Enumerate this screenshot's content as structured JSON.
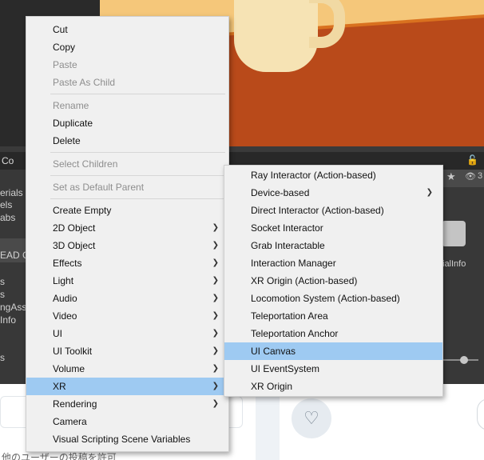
{
  "editor": {
    "panel_title": "Co",
    "hidden_count": "3",
    "left_items": [
      "erials",
      "els",
      "abs",
      "EAD G",
      "s",
      "s",
      "ngAss",
      "Info",
      "s"
    ],
    "right_item_label": "ialInfo"
  },
  "web": {
    "bottom_text": "他のユーザーの投稿を許可"
  },
  "context_menu": {
    "items": [
      {
        "label": "Cut",
        "disabled": false
      },
      {
        "label": "Copy",
        "disabled": false
      },
      {
        "label": "Paste",
        "disabled": true
      },
      {
        "label": "Paste As Child",
        "disabled": true
      },
      {
        "label": "Rename",
        "disabled": true
      },
      {
        "label": "Duplicate",
        "disabled": false
      },
      {
        "label": "Delete",
        "disabled": false
      },
      {
        "label": "Select Children",
        "disabled": true
      },
      {
        "label": "Set as Default Parent",
        "disabled": true
      },
      {
        "label": "Create Empty",
        "disabled": false
      },
      {
        "label": "2D Object",
        "disabled": false,
        "submenu": true
      },
      {
        "label": "3D Object",
        "disabled": false,
        "submenu": true
      },
      {
        "label": "Effects",
        "disabled": false,
        "submenu": true
      },
      {
        "label": "Light",
        "disabled": false,
        "submenu": true
      },
      {
        "label": "Audio",
        "disabled": false,
        "submenu": true
      },
      {
        "label": "Video",
        "disabled": false,
        "submenu": true
      },
      {
        "label": "UI",
        "disabled": false,
        "submenu": true
      },
      {
        "label": "UI Toolkit",
        "disabled": false,
        "submenu": true
      },
      {
        "label": "Volume",
        "disabled": false,
        "submenu": true
      },
      {
        "label": "XR",
        "disabled": false,
        "submenu": true,
        "highlighted": true
      },
      {
        "label": "Rendering",
        "disabled": false,
        "submenu": true
      },
      {
        "label": "Camera",
        "disabled": false
      },
      {
        "label": "Visual Scripting Scene Variables",
        "disabled": false
      }
    ]
  },
  "xr_submenu": {
    "items": [
      {
        "label": "Ray Interactor (Action-based)"
      },
      {
        "label": "Device-based",
        "submenu": true
      },
      {
        "label": "Direct Interactor (Action-based)"
      },
      {
        "label": "Socket Interactor"
      },
      {
        "label": "Grab Interactable"
      },
      {
        "label": "Interaction Manager"
      },
      {
        "label": "XR Origin (Action-based)"
      },
      {
        "label": "Locomotion System (Action-based)"
      },
      {
        "label": "Teleportation Area"
      },
      {
        "label": "Teleportation Anchor"
      },
      {
        "label": "UI Canvas",
        "highlighted": true
      },
      {
        "label": "UI EventSystem"
      },
      {
        "label": "XR Origin"
      }
    ]
  },
  "icons": {
    "submenu_arrow": "chevron-right-icon",
    "lock": "lock-icon",
    "favorite": "star-icon",
    "visibility": "eye-slash-icon",
    "like": "heart-icon"
  },
  "colors": {
    "highlight": "#9ecaf2",
    "menu_bg": "#f0f0f0",
    "disabled_text": "#8e8e8e"
  }
}
